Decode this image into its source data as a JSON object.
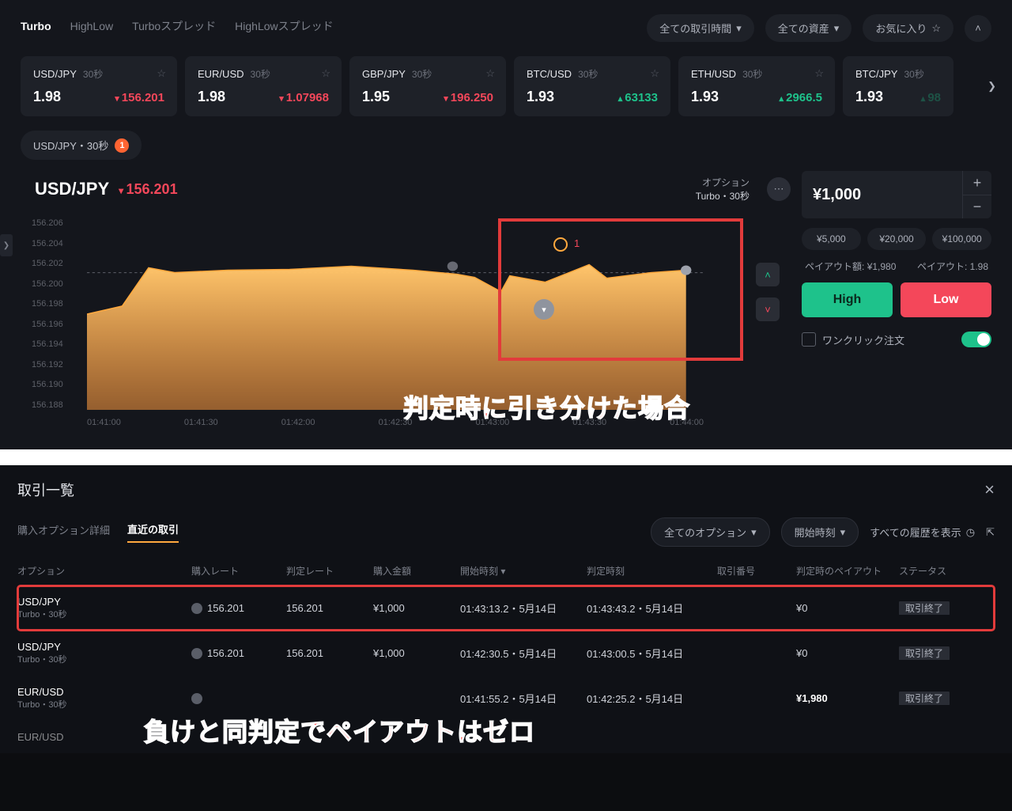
{
  "tabs": [
    "Turbo",
    "HighLow",
    "Turboスプレッド",
    "HighLowスプレッド"
  ],
  "filters": {
    "time": "全ての取引時間",
    "asset": "全ての資産",
    "fav": "お気に入り"
  },
  "cards": [
    {
      "pair": "USD/JPY",
      "dur": "30秒",
      "rate": "1.98",
      "val": "156.201",
      "dir": "down"
    },
    {
      "pair": "EUR/USD",
      "dur": "30秒",
      "rate": "1.98",
      "val": "1.07968",
      "dir": "down"
    },
    {
      "pair": "GBP/JPY",
      "dur": "30秒",
      "rate": "1.95",
      "val": "196.250",
      "dir": "down"
    },
    {
      "pair": "BTC/USD",
      "dur": "30秒",
      "rate": "1.93",
      "val": "63133",
      "dir": "up"
    },
    {
      "pair": "ETH/USD",
      "dur": "30秒",
      "rate": "1.93",
      "val": "2966.5",
      "dir": "up"
    },
    {
      "pair": "BTC/JPY",
      "dur": "30秒",
      "rate": "1.93",
      "val": "98",
      "dir": "up"
    }
  ],
  "assetTab": {
    "label": "USD/JPY・30秒",
    "count": "1"
  },
  "chart": {
    "pair": "USD/JPY",
    "val": "156.201",
    "optionLabel": "オプション",
    "optionSub": "Turbo・30秒",
    "orderCount": "1"
  },
  "chart_data": {
    "type": "area",
    "title": "USD/JPY",
    "xlabel": "",
    "ylabel": "",
    "ylim": [
      156.188,
      156.206
    ],
    "y_ticks": [
      "156.206",
      "156.204",
      "156.202",
      "156.200",
      "156.198",
      "156.196",
      "156.194",
      "156.192",
      "156.190",
      "156.188"
    ],
    "x_ticks": [
      "01:41:00",
      "01:41:30",
      "01:42:00",
      "01:42:30",
      "01:43:00",
      "01:43:30",
      "01:44:00"
    ],
    "entry_line": 156.201,
    "x": [
      "01:40:45",
      "01:41:00",
      "01:41:10",
      "01:41:15",
      "01:41:30",
      "01:41:45",
      "01:42:00",
      "01:42:15",
      "01:42:30",
      "01:42:45",
      "01:42:50",
      "01:43:00",
      "01:43:15",
      "01:43:30",
      "01:43:40"
    ],
    "values": [
      156.198,
      156.199,
      156.201,
      156.2005,
      156.201,
      156.201,
      156.2015,
      156.201,
      156.2005,
      156.2,
      156.1995,
      156.201,
      156.2,
      156.201,
      156.201
    ]
  },
  "order": {
    "amount": "¥1,000",
    "presets": [
      "¥5,000",
      "¥20,000",
      "¥100,000"
    ],
    "payoutAmtLabel": "ペイアウト額:",
    "payoutAmt": "¥1,980",
    "payoutRateLabel": "ペイアウト:",
    "payoutRate": "1.98",
    "high": "High",
    "low": "Low",
    "oneClick": "ワンクリック注文"
  },
  "annotations": {
    "a1": "判定時に引き分けた場合",
    "a2": "負けと同判定でペイアウトはゼロ"
  },
  "bottom": {
    "title": "取引一覧",
    "subtabs": [
      "購入オプション詳細",
      "直近の取引"
    ],
    "filters": {
      "opt": "全てのオプション",
      "start": "開始時刻",
      "history": "すべての履歴を表示"
    },
    "columns": [
      "オプション",
      "購入レート",
      "判定レート",
      "購入金額",
      "開始時刻",
      "判定時刻",
      "取引番号",
      "判定時のペイアウト",
      "ステータス"
    ],
    "rows": [
      {
        "pair": "USD/JPY",
        "sub": "Turbo・30秒",
        "buyRate": "156.201",
        "judgeRate": "156.201",
        "amt": "¥1,000",
        "start": "01:43:13.2・5月14日",
        "jtime": "01:43:43.2・5月14日",
        "tno": "",
        "pay": "¥0",
        "status": "取引終了",
        "hi": true
      },
      {
        "pair": "USD/JPY",
        "sub": "Turbo・30秒",
        "buyRate": "156.201",
        "judgeRate": "156.201",
        "amt": "¥1,000",
        "start": "01:42:30.5・5月14日",
        "jtime": "01:43:00.5・5月14日",
        "tno": "",
        "pay": "¥0",
        "status": "取引終了",
        "hi": false
      },
      {
        "pair": "EUR/USD",
        "sub": "Turbo・30秒",
        "buyRate": "",
        "judgeRate": "",
        "amt": "",
        "start": "01:41:55.2・5月14日",
        "jtime": "01:42:25.2・5月14日",
        "tno": "",
        "pay": "¥1,980",
        "status": "取引終了",
        "hi": false
      },
      {
        "pair": "EUR/USD",
        "sub": "",
        "buyRate": "",
        "judgeRate": "",
        "amt": "",
        "start": "",
        "jtime": "",
        "tno": "",
        "pay": "",
        "status": "",
        "hi": false
      }
    ]
  }
}
